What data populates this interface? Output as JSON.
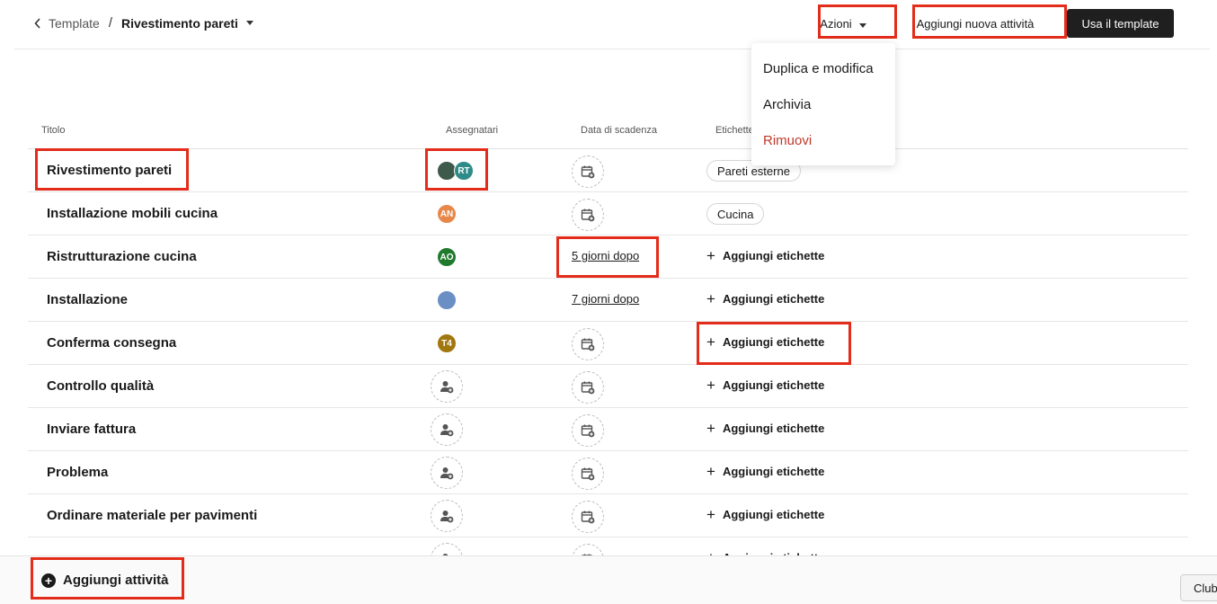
{
  "breadcrumb": {
    "parent": "Template",
    "separator": "/",
    "current": "Rivestimento pareti"
  },
  "header": {
    "actions_label": "Azioni",
    "add_task_label": "Aggiungi nuova attività",
    "use_template_label": "Usa il template"
  },
  "actions_menu": {
    "items": [
      {
        "label": "Duplica e modifica"
      },
      {
        "label": "Archivia"
      },
      {
        "label": "Rimuovi"
      }
    ],
    "danger_color": "#c0392b"
  },
  "table": {
    "columns": {
      "title": "Titolo",
      "assignees": "Assegnatari",
      "due_date": "Data di scadenza",
      "labels": "Etichette"
    },
    "add_labels_text": "Aggiungi etichette",
    "rows": [
      {
        "title": "Rivestimento pareti",
        "assignees": [
          {
            "initials": "",
            "color": "#3d5a4a"
          },
          {
            "initials": "RT",
            "color": "#2e8b88"
          }
        ],
        "due": "",
        "labels": [
          "Pareti esterne"
        ]
      },
      {
        "title": "Installazione mobili cucina",
        "assignees": [
          {
            "initials": "AN",
            "color": "#e8874a"
          }
        ],
        "due": "",
        "labels": [
          "Cucina"
        ]
      },
      {
        "title": "Ristrutturazione cucina",
        "assignees": [
          {
            "initials": "AO",
            "color": "#1f7a2e"
          }
        ],
        "due": "5 giorni dopo",
        "labels": []
      },
      {
        "title": "Installazione",
        "assignees": [
          {
            "initials": "",
            "color": "#6a8fc4"
          }
        ],
        "due": "7 giorni dopo",
        "labels": []
      },
      {
        "title": "Conferma consegna",
        "assignees": [
          {
            "initials": "T4",
            "color": "#a0780f"
          }
        ],
        "due": "",
        "labels": []
      },
      {
        "title": "Controllo qualità",
        "assignees": [],
        "due": "",
        "labels": []
      },
      {
        "title": "Inviare fattura",
        "assignees": [],
        "due": "",
        "labels": []
      },
      {
        "title": "Problema",
        "assignees": [],
        "due": "",
        "labels": []
      },
      {
        "title": "Ordinare materiale per pavimenti",
        "assignees": [],
        "due": "",
        "labels": []
      },
      {
        "title": "",
        "assignees": [],
        "due": "",
        "labels": []
      }
    ]
  },
  "footer": {
    "add_activity_label": "Aggiungi attività",
    "corner_button_label": "Club"
  },
  "highlight_color": "#e32c1a"
}
